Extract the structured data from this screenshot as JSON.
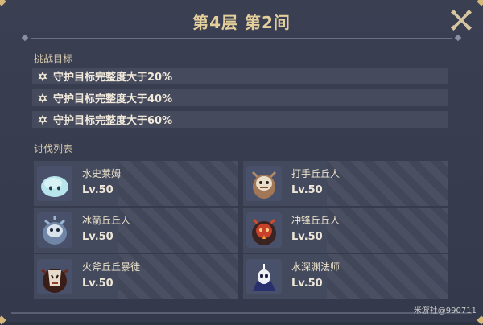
{
  "header": {
    "title": "第4层 第2间"
  },
  "challenge": {
    "section_label": "挑战目标",
    "goals": [
      {
        "text": "守护目标完整度大于20%"
      },
      {
        "text": "守护目标完整度大于40%"
      },
      {
        "text": "守护目标完整度大于60%"
      }
    ]
  },
  "enemies": {
    "section_label": "讨伐列表",
    "list": [
      {
        "name": "水史莱姆",
        "level": "Lv.50",
        "icon": "slime-icon"
      },
      {
        "name": "打手丘丘人",
        "level": "Lv.50",
        "icon": "hilichurl-fighter-icon"
      },
      {
        "name": "冰箭丘丘人",
        "level": "Lv.50",
        "icon": "cryo-hilichurl-icon"
      },
      {
        "name": "冲锋丘丘人",
        "level": "Lv.50",
        "icon": "hilichurl-berserker-icon"
      },
      {
        "name": "火斧丘丘暴徒",
        "level": "Lv.50",
        "icon": "pyro-mitachurl-icon"
      },
      {
        "name": "水深渊法师",
        "level": "Lv.50",
        "icon": "hydro-abyss-mage-icon"
      }
    ]
  },
  "watermark": "米游社@990711",
  "colors": {
    "title": "#e4cf9c",
    "panel": "#3a3f52",
    "row": "#454a5c"
  }
}
